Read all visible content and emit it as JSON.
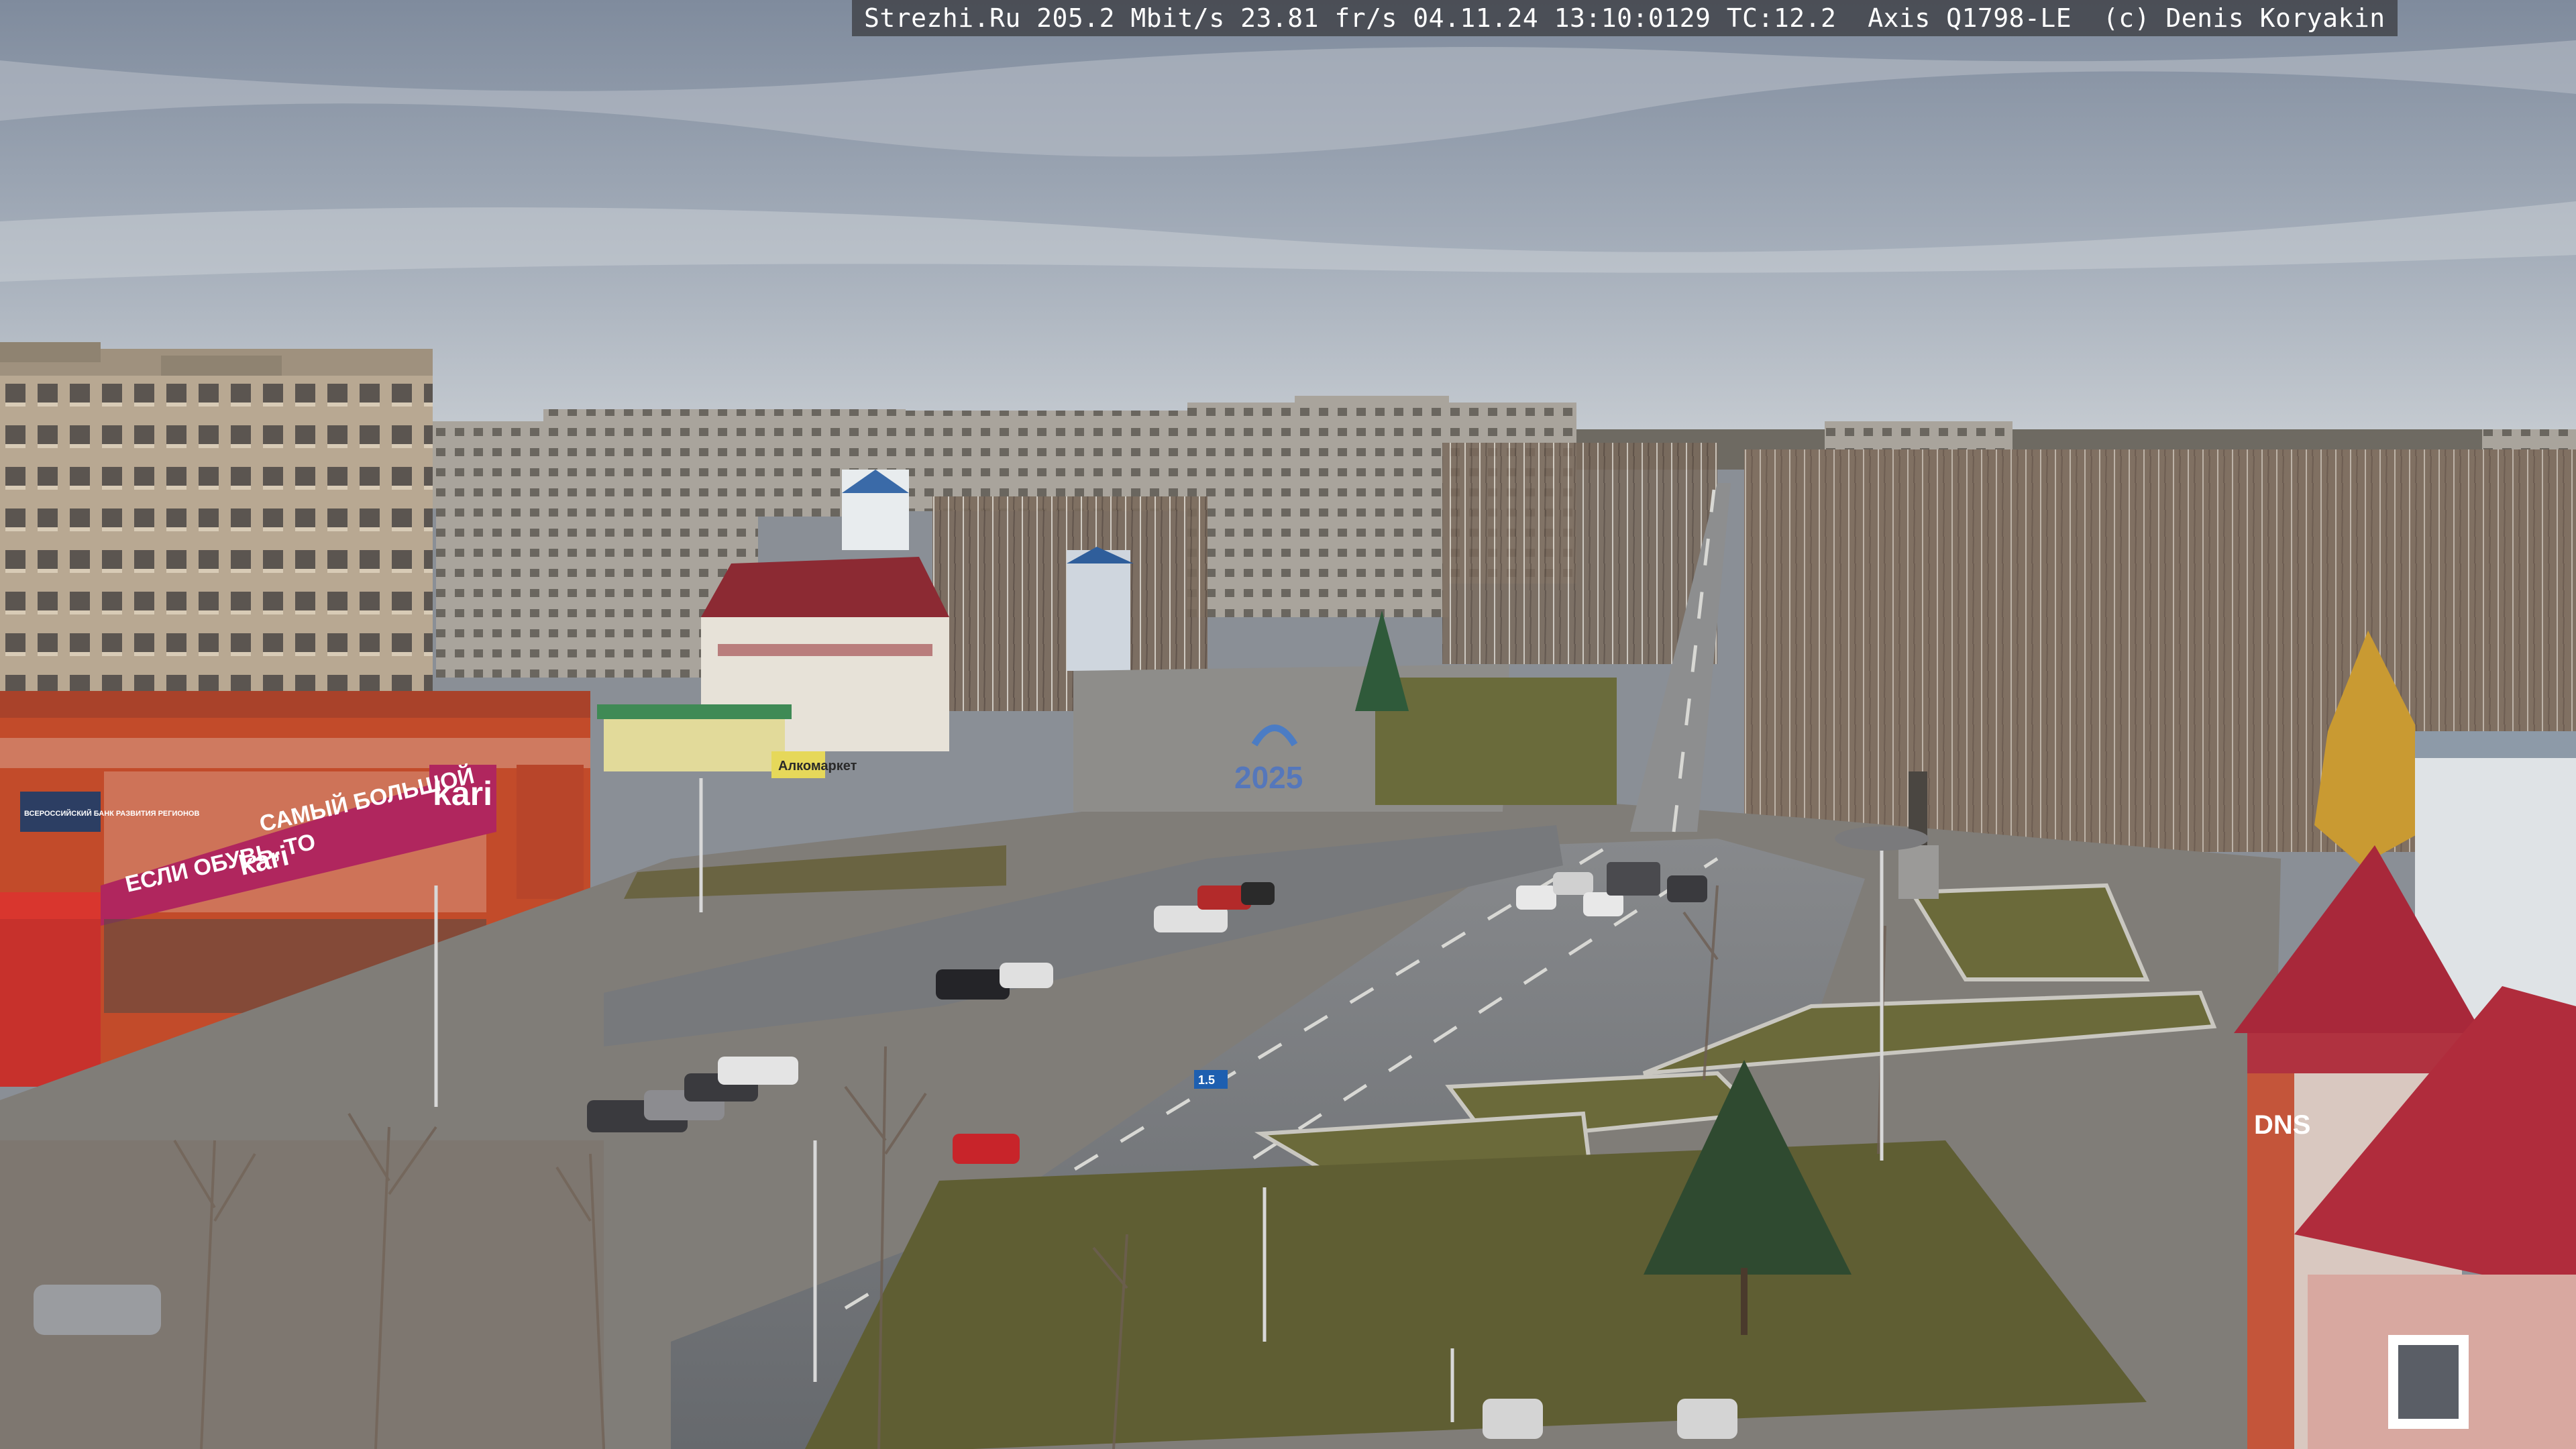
{
  "camera_overlay": {
    "text": "Strezhi.Ru 205.2 Mbit/s 23.81 fr/s 04.11.24 13:10:0129 TC:12.2  Axis Q1798-LE  (c) Denis Koryakin"
  },
  "storefront": {
    "brand": "kari",
    "banner_sub": "САМЫЙ БОЛЬШОЙ",
    "banner_left": "ЕСЛИ ОБУВЬ, ТО",
    "banner_left_brand": "kari",
    "office_sign": "ВСЕРОССИЙСКИЙ БАНК РАЗВИТИЯ РЕГИОНОВ"
  },
  "right_building": {
    "sign": "DNS"
  },
  "kiosk": {
    "sign": "Алкомаркет"
  },
  "square": {
    "year_sign": "2025"
  },
  "road_sign": {
    "text": "1.5"
  },
  "colors": {
    "sky_top": "#7e8a9c",
    "sky_bottom": "#c7ccd2",
    "kari_magenta": "#b0265e",
    "roof_red": "#a8283a",
    "asphalt": "#6f7276",
    "grass": "#6b6a3a"
  }
}
